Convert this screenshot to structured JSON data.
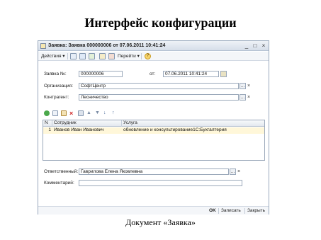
{
  "slide": {
    "title": "Интерфейс конфигурации",
    "caption": "Документ «Заявка»"
  },
  "window": {
    "title": "Заявка: Заявка 000000006 от 07.06.2011 10:41:24",
    "minimize": "_",
    "maximize": "□",
    "close": "×"
  },
  "toolbar": {
    "actions_label": "Действия",
    "goto_label": "Перейти",
    "dropdown_arrow": "▾",
    "help_glyph": "?"
  },
  "form": {
    "number_label": "Заявка №:",
    "number_value": "000000006",
    "date_label": "от:",
    "date_value": "07.06.2011 10:41:24",
    "org_label": "Организация:",
    "org_value": "СофтЦентр",
    "contractor_label": "Контрагент:",
    "contractor_value": "Лесничество",
    "responsible_label": "Ответственный:",
    "responsible_value": "Гаврилова Елена Яковлевна",
    "comment_label": "Комментарий:",
    "comment_value": "",
    "select_button": "...",
    "clear_button": "×"
  },
  "table": {
    "columns": [
      "N",
      "Сотрудник",
      "Услуга"
    ],
    "rows": [
      {
        "n": "1",
        "employee": "Иванов Иван Иванович",
        "service": "обновление и консультирование1С:Бухгалтерия"
      }
    ]
  },
  "bottom": {
    "ok_label": "OK",
    "save_label": "Записать",
    "close_label": "Закрыть"
  },
  "colors": {
    "selected_row": "#fff7d9",
    "window_border": "#98a8bd"
  }
}
